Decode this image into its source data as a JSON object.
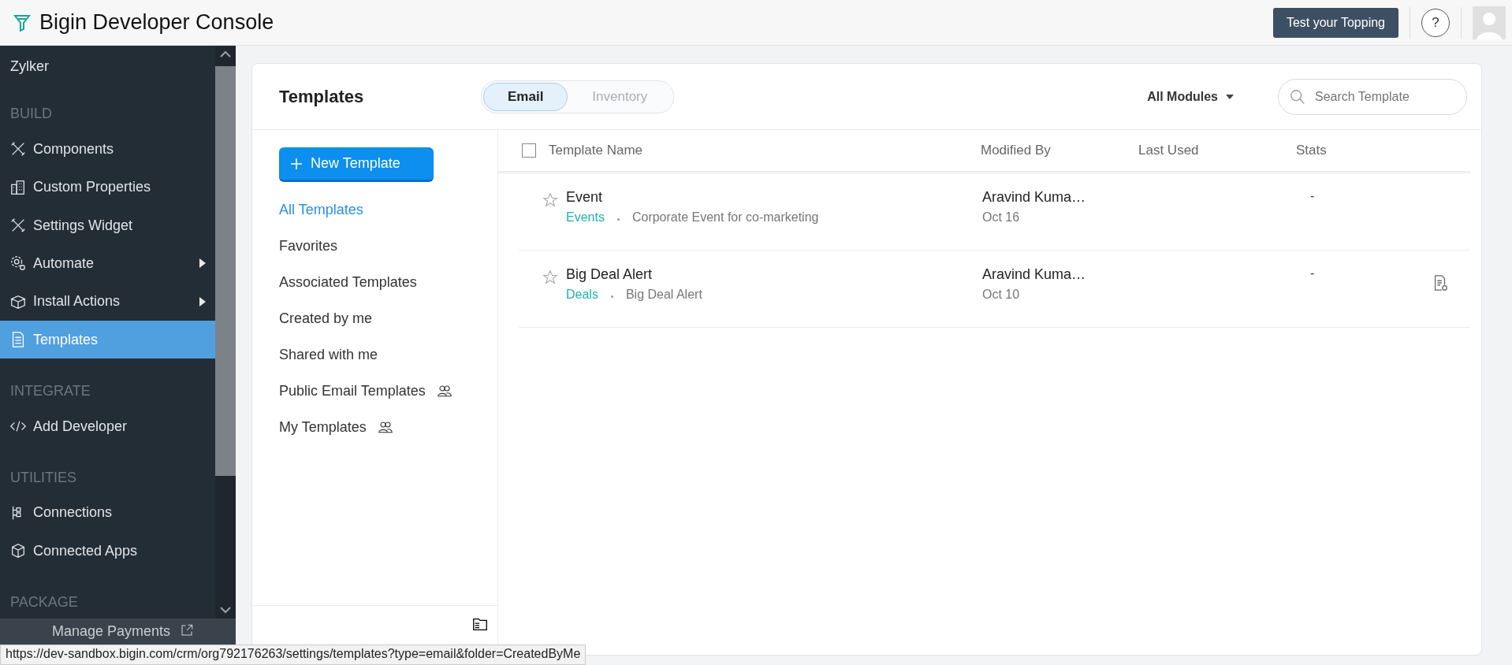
{
  "app": {
    "title": "Bigin Developer Console"
  },
  "header": {
    "action_button": "Test your Topping",
    "help": "?"
  },
  "sidebar": {
    "items": [
      {
        "kind": "org",
        "label": "Zylker"
      },
      {
        "kind": "heading",
        "label": "BUILD"
      },
      {
        "kind": "item",
        "label": "Components",
        "selected": false,
        "submenu": false
      },
      {
        "kind": "item",
        "label": "Custom Properties",
        "selected": false,
        "submenu": false
      },
      {
        "kind": "item",
        "label": "Settings Widget",
        "selected": false,
        "submenu": false
      },
      {
        "kind": "item",
        "label": "Automate",
        "selected": false,
        "submenu": true
      },
      {
        "kind": "item",
        "label": "Install Actions",
        "selected": false,
        "submenu": true
      },
      {
        "kind": "item",
        "label": "Templates",
        "selected": true,
        "submenu": false
      },
      {
        "kind": "heading",
        "label": "INTEGRATE"
      },
      {
        "kind": "item",
        "label": "Add Developer",
        "selected": false,
        "submenu": false
      },
      {
        "kind": "heading",
        "label": "UTILITIES"
      },
      {
        "kind": "item",
        "label": "Connections",
        "selected": false,
        "submenu": false
      },
      {
        "kind": "item",
        "label": "Connected Apps",
        "selected": false,
        "submenu": false
      },
      {
        "kind": "heading",
        "label": "PACKAGE"
      }
    ],
    "footer_item": "Manage Payments"
  },
  "templates": {
    "title": "Templates",
    "tabs": [
      {
        "label": "Email",
        "selected": true
      },
      {
        "label": "Inventory",
        "selected": false
      }
    ],
    "module_filter": "All Modules",
    "search": {
      "placeholder": "Search Template"
    },
    "new_button": "New Template",
    "folders": [
      {
        "label": "All Templates",
        "selected": true,
        "shared": false
      },
      {
        "label": "Favorites",
        "selected": false,
        "shared": false
      },
      {
        "label": "Associated Templates",
        "selected": false,
        "shared": false
      },
      {
        "label": "Created by me",
        "selected": false,
        "shared": false
      },
      {
        "label": "Shared with me",
        "selected": false,
        "shared": false
      },
      {
        "label": "Public Email Templates",
        "selected": false,
        "shared": true
      },
      {
        "label": "My Templates",
        "selected": false,
        "shared": true
      }
    ],
    "table": {
      "select_all": {
        "checked": false
      },
      "columns": [
        "Template Name",
        "Modified By",
        "Last Used",
        "Stats"
      ],
      "rows": [
        {
          "name": "Event",
          "module": "Events",
          "description": "Corporate Event for co-marketing",
          "modified_by": "Aravind Kuma…",
          "modified_date": "Oct 16",
          "stats": "-",
          "favorite": false,
          "document_icon": false
        },
        {
          "name": "Big Deal Alert",
          "module": "Deals",
          "description": "Big Deal Alert",
          "modified_by": "Aravind Kuma…",
          "modified_date": "Oct 10",
          "stats": "-",
          "favorite": false,
          "document_icon": true
        }
      ]
    }
  },
  "status_bar": {
    "url": "https://dev-sandbox.bigin.com/crm/org792176263/settings/templates?type=email&folder=CreatedByMe"
  }
}
